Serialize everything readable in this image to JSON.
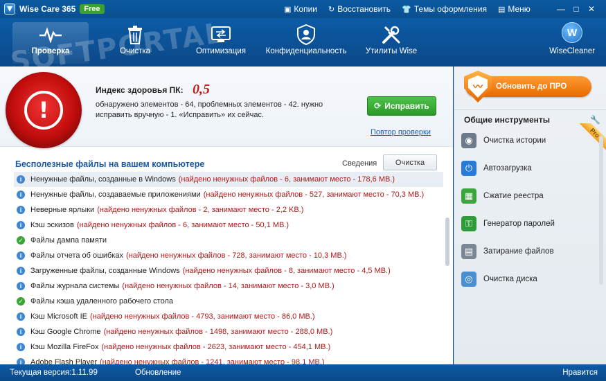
{
  "titlebar": {
    "app_name": "Wise Care 365",
    "badge": "Free",
    "menu": [
      {
        "label": "Копии",
        "icon": "monitor-icon"
      },
      {
        "label": "Восстановить",
        "icon": "restore-icon"
      },
      {
        "label": "Темы оформления",
        "icon": "shirt-icon"
      },
      {
        "label": "Меню",
        "icon": "menu-icon"
      }
    ]
  },
  "nav": {
    "tabs": [
      {
        "label": "Проверка",
        "icon": "pulse-icon",
        "active": true
      },
      {
        "label": "Очистка",
        "icon": "trash-icon"
      },
      {
        "label": "Оптимизация",
        "icon": "optimize-icon"
      },
      {
        "label": "Конфиденциальность",
        "icon": "privacy-shield-icon"
      },
      {
        "label": "Утилиты Wise",
        "icon": "tools-icon"
      }
    ],
    "wisecleaner": {
      "label": "WiseCleaner",
      "logo_letter": "W"
    }
  },
  "health": {
    "label": "Индекс здоровья ПК:",
    "score": "0,5",
    "description": "обнаружено элементов - 64, проблемных элементов - 42. нужно исправить вручную - 1. «Исправить» их сейчас.",
    "fix_button": "Исправить",
    "rescan_link": "Повтор проверки"
  },
  "junk": {
    "title": "Бесполезные файлы на вашем компьютере",
    "details_link": "Сведения",
    "clean_button": "Очистка",
    "items": [
      {
        "name": "Ненужные файлы, созданные в Windows",
        "detail": "(найдено ненужных файлов - 6, занимают место - 178,6 MB.)",
        "status": "info"
      },
      {
        "name": "Ненужные файлы, создаваемые приложениями",
        "detail": "(найдено ненужных файлов - 527, занимают место - 70,3 MB.)",
        "status": "info"
      },
      {
        "name": "Неверные ярлыки",
        "detail": "(найдено ненужных файлов - 2, занимают место - 2,2 KB.)",
        "status": "info"
      },
      {
        "name": "Кэш эскизов",
        "detail": "(найдено ненужных файлов - 6, занимают место - 50,1 MB.)",
        "status": "info"
      },
      {
        "name": "Файлы дампа памяти",
        "detail": "",
        "status": "ok"
      },
      {
        "name": "Файлы отчета об ошибках",
        "detail": "(найдено ненужных файлов - 728, занимают место - 10,3 MB.)",
        "status": "info"
      },
      {
        "name": "Загруженные файлы, созданные Windows",
        "detail": "(найдено ненужных файлов - 8, занимают место - 4,5 MB.)",
        "status": "info"
      },
      {
        "name": "Файлы журнала системы",
        "detail": "(найдено ненужных файлов - 14, занимают место - 3,0 MB.)",
        "status": "info"
      },
      {
        "name": "Файлы кэша удаленного рабочего стола",
        "detail": "",
        "status": "ok"
      },
      {
        "name": "Кэш Microsoft IE",
        "detail": "(найдено ненужных файлов - 4793, занимают место - 86,0 MB.)",
        "status": "info"
      },
      {
        "name": "Кэш Google Chrome",
        "detail": "(найдено ненужных файлов - 1498, занимают место - 288,0 MB.)",
        "status": "info"
      },
      {
        "name": "Кэш Mozilla FireFox",
        "detail": "(найдено ненужных файлов - 2623, занимают место - 454,1 MB.)",
        "status": "info"
      },
      {
        "name": "Adobe Flash Player",
        "detail": "(найдено ненужных файлов - 1241, занимают место - 98,1 MB.)",
        "status": "info"
      }
    ]
  },
  "sidebar": {
    "upgrade_button": "Обновить до ПРО",
    "tools_title": "Общие инструменты",
    "pro_ribbon": "Pro",
    "tools": [
      {
        "label": "Очистка истории",
        "icon": "eye-history-icon",
        "color": "#6c7a89"
      },
      {
        "label": "Автозагрузка",
        "icon": "power-icon",
        "color": "#2a7bd3"
      },
      {
        "label": "Сжатие реестра",
        "icon": "registry-cubes-icon",
        "color": "#3aa53a"
      },
      {
        "label": "Генератор паролей",
        "icon": "key-icon",
        "color": "#2f9a3a"
      },
      {
        "label": "Затирание файлов",
        "icon": "shredder-icon",
        "color": "#7b8794"
      },
      {
        "label": "Очистка диска",
        "icon": "disk-clean-icon",
        "color": "#4a8fd0"
      }
    ]
  },
  "statusbar": {
    "version": "Текущая версия:1.11.99",
    "update": "Обновление",
    "like": "Нравится"
  },
  "watermark": "SOFTPORTAL"
}
